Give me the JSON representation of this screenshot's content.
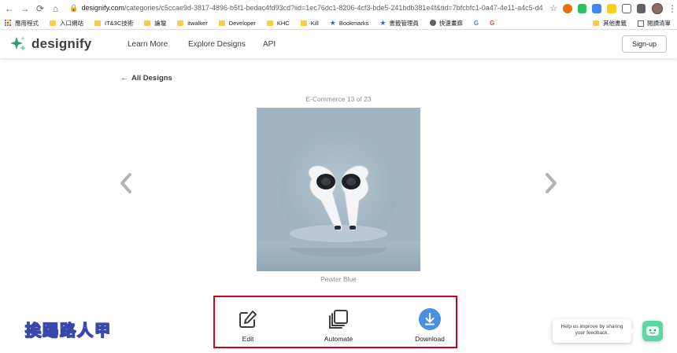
{
  "browser": {
    "url_host": "designify.com",
    "url_rest": "/categories/c5ccae9d-3817-4896-b5f1-bedac4fd93cd?iid=1ec76dc1-8206-4cf3-bde5-241bdb381e4f&tid=7bfcbfc1-0a47-4e11-a4c5-d43d4350..."
  },
  "bookmarks": {
    "items": [
      "應用程式",
      "入口網站",
      "IT&3C技術",
      "論壇",
      "itwalker",
      "Developer",
      "KHC",
      "Kill",
      "Bookmarks",
      "書籤管理員",
      "快速畫廊",
      "G",
      "G"
    ],
    "other_bookmarks": "其他書籤",
    "reading_list": "閱讀清單"
  },
  "site": {
    "brand": "designify",
    "nav": [
      "Learn More",
      "Explore Designs",
      "API"
    ],
    "signup_label": "Sign-up"
  },
  "main": {
    "back_label": "All Designs",
    "counter": "E-Commerce 13 of 23",
    "caption": "Pewter Blue"
  },
  "actions": {
    "edit": "Edit",
    "automate": "Automate",
    "download": "Download"
  },
  "watermark": "挨踢路人甲",
  "feedback": {
    "line1": "Help us improve by sharing",
    "line2": "your feedback."
  },
  "colors": {
    "accent_blue": "#4a90e2",
    "image_bg": "#9fb1be",
    "highlight_red": "#d0021b",
    "bot_green": "#5cd6a3"
  }
}
